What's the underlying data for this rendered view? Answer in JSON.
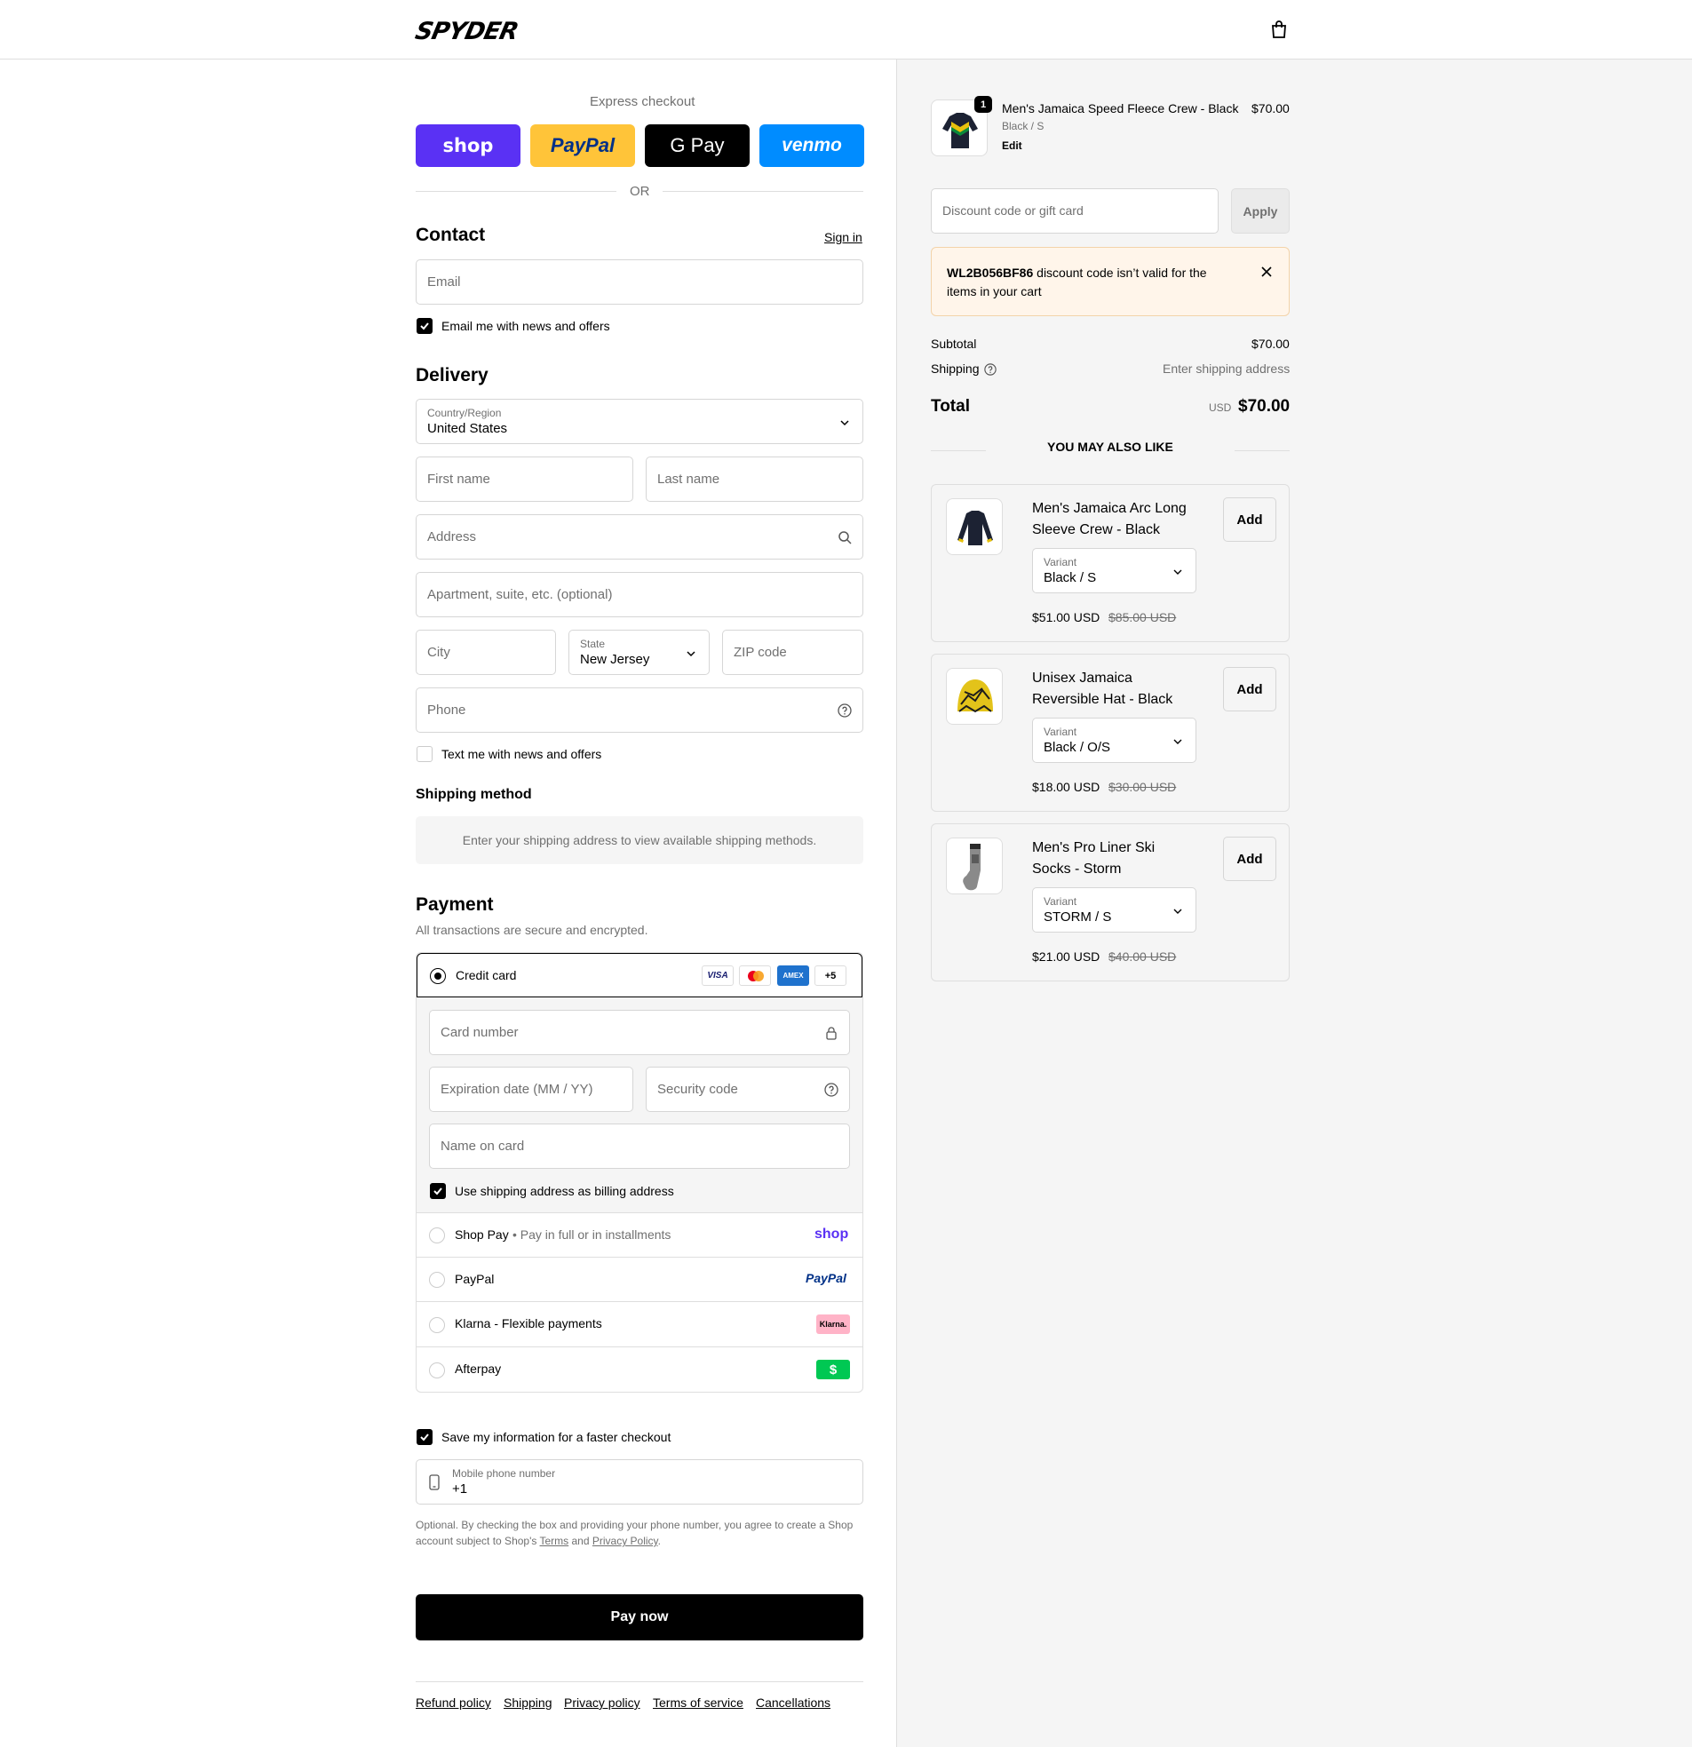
{
  "header": {
    "brand": "SPYDER",
    "bag_icon": "shopping-bag-icon"
  },
  "express": {
    "title": "Express checkout",
    "buttons": [
      {
        "label": "shop",
        "color": "#5a31f4"
      },
      {
        "label": "PayPal",
        "color": "#ffc439"
      },
      {
        "label": "G Pay",
        "color": "#000000"
      },
      {
        "label": "venmo",
        "color": "#008cff"
      }
    ],
    "or": "OR"
  },
  "contact": {
    "title": "Contact",
    "sign_in": "Sign in",
    "email_placeholder": "Email",
    "news_label": "Email me with news and offers",
    "news_checked": true
  },
  "delivery": {
    "title": "Delivery",
    "country_label": "Country/Region",
    "country_value": "United States",
    "first_name": "First name",
    "last_name": "Last name",
    "address": "Address",
    "apartment": "Apartment, suite, etc. (optional)",
    "city": "City",
    "state_label": "State",
    "state_value": "New Jersey",
    "zip": "ZIP code",
    "phone": "Phone",
    "text_label": "Text me with news and offers",
    "text_checked": false
  },
  "shipping_method": {
    "title": "Shipping method",
    "message": "Enter your shipping address to view available shipping methods."
  },
  "payment": {
    "title": "Payment",
    "subtitle": "All transactions are secure and encrypted.",
    "credit_card": "Credit card",
    "card_brands": [
      "VISA",
      "Mastercard",
      "AMEX",
      "+5"
    ],
    "card_number": "Card number",
    "expiry": "Expiration date (MM / YY)",
    "security": "Security code",
    "name_on_card": "Name on card",
    "billing_label": "Use shipping address as billing address",
    "options": [
      {
        "label": "Shop Pay",
        "sub": "Pay in full or in installments",
        "logo": "shop"
      },
      {
        "label": "PayPal",
        "sub": "",
        "logo": "PayPal"
      },
      {
        "label": "Klarna - Flexible payments",
        "sub": "",
        "logo": "Klarna."
      },
      {
        "label": "Afterpay",
        "sub": "",
        "logo": "$"
      }
    ]
  },
  "save": {
    "label": "Save my information for a faster checkout",
    "phone_label": "Mobile phone number",
    "phone_value": "+1",
    "legal_1": "Optional. By checking the box and providing your phone number, you agree to create a Shop account subject to Shop's ",
    "terms": "Terms",
    "and": " and ",
    "privacy": "Privacy Policy",
    "end": "."
  },
  "pay_now": "Pay now",
  "footer": [
    "Refund policy",
    "Shipping",
    "Privacy policy",
    "Terms of service",
    "Cancellations"
  ],
  "summary": {
    "item": {
      "qty": "1",
      "name": "Men's Jamaica Speed Fleece Crew - Black",
      "variant": "Black / S",
      "edit": "Edit",
      "price": "$70.00"
    },
    "discount_placeholder": "Discount code or gift card",
    "apply": "Apply",
    "alert_code": "WL2B056BF86",
    "alert_text": " discount code isn’t valid for the items in your cart",
    "subtotal_label": "Subtotal",
    "subtotal": "$70.00",
    "shipping_label": "Shipping",
    "shipping_value": "Enter shipping address",
    "total_label": "Total",
    "currency": "USD",
    "total": "$70.00",
    "upsell_title": "YOU MAY ALSO LIKE",
    "upsells": [
      {
        "name_1": "Men's Jamaica Arc Long",
        "name_2": "Sleeve Crew - Black",
        "variant_label": "Variant",
        "variant": "Black / S",
        "price": "$51.00 USD",
        "compare": "$85.00 USD",
        "add": "Add"
      },
      {
        "name_1": "Unisex Jamaica",
        "name_2": "Reversible Hat - Black",
        "variant_label": "Variant",
        "variant": "Black / O/S",
        "price": "$18.00 USD",
        "compare": "$30.00 USD",
        "add": "Add"
      },
      {
        "name_1": "Men's Pro Liner Ski",
        "name_2": "Socks - Storm",
        "variant_label": "Variant",
        "variant": "STORM / S",
        "price": "$21.00 USD",
        "compare": "$40.00 USD",
        "add": "Add"
      }
    ]
  }
}
